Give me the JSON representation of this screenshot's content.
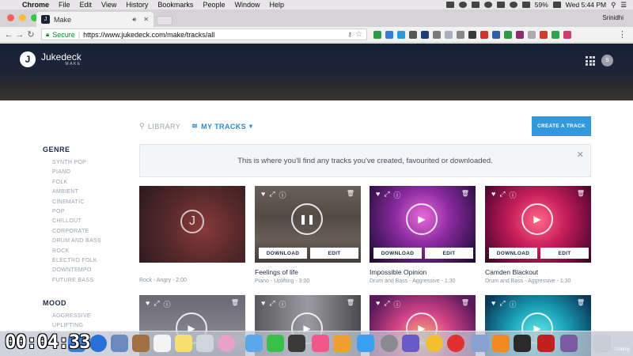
{
  "menubar": {
    "app": "Chrome",
    "items": [
      "File",
      "Edit",
      "View",
      "History",
      "Bookmarks",
      "People",
      "Window",
      "Help"
    ],
    "battery": "59%",
    "clock": "Wed 5:44 PM"
  },
  "browser": {
    "tab_title": "Make",
    "tab_favicon": "J",
    "profile": "Srinidhi",
    "secure_label": "Secure",
    "url": "https://www.jukedeck.com/make/tracks/all"
  },
  "site": {
    "brand": "Jukedeck",
    "brand_sub": "MAKE",
    "avatar_initial": "S",
    "nav_library": "LIBRARY",
    "nav_my_tracks": "MY TRACKS",
    "create_button": "CREATE A TRACK",
    "notice": "This is where you'll find any tracks you've created, favourited or downloaded."
  },
  "sidebar": {
    "genre_heading": "GENRE",
    "genres": [
      "SYNTH POP",
      "PIANO",
      "FOLK",
      "AMBIENT",
      "CINEMATIC",
      "POP",
      "CHILLOUT",
      "CORPORATE",
      "DRUM AND BASS",
      "ROCK",
      "ELECTRO FOLK",
      "DOWNTEMPO",
      "FUTURE BASS"
    ],
    "mood_heading": "MOOD",
    "moods": [
      "AGGRESSIVE",
      "UPLIFTING"
    ]
  },
  "tracks": [
    {
      "title": "",
      "meta": "Rock - Angry - 2:00"
    },
    {
      "title": "Feelings of life",
      "meta": "Piano - Uplifting - 3:00"
    },
    {
      "title": "Impossible Opinion",
      "meta": "Drum and Bass - Aggressive - 1:30"
    },
    {
      "title": "Camden Blackout",
      "meta": "Drum and Bass - Aggressive - 1:30"
    }
  ],
  "card_buttons": {
    "download": "DOWNLOAD",
    "edit": "EDIT"
  },
  "video": {
    "timestamp": "00:04:33",
    "watermark": "Udemy"
  },
  "colors": {
    "accent": "#3399dd",
    "header_bg": "#172136",
    "heading": "#1d2a44"
  }
}
